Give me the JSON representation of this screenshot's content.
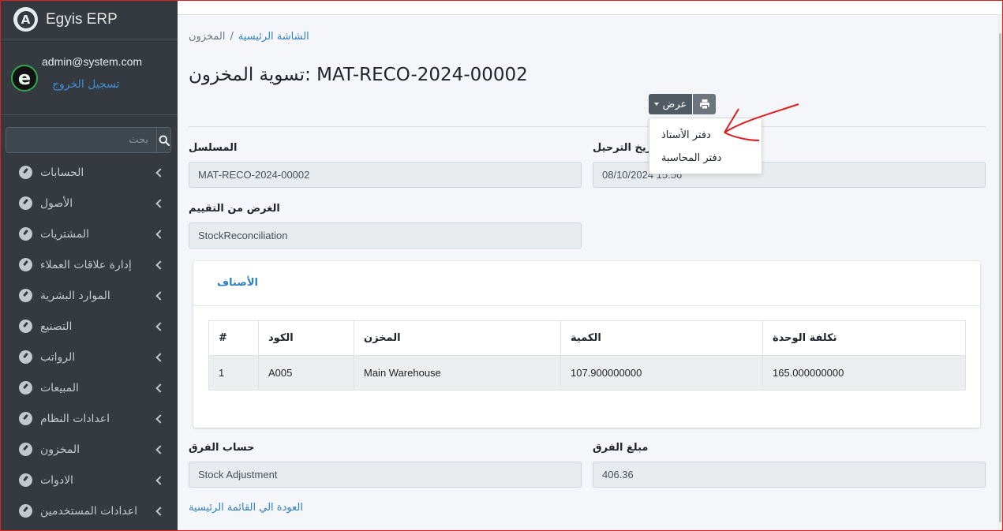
{
  "app": {
    "brand": "Egyis ERP",
    "brand_logo_letter": "A"
  },
  "user": {
    "email": "admin@system.com",
    "logout": "تسجيل الخروج",
    "avatar_letter": "e"
  },
  "sidebar": {
    "search_placeholder": "بحث",
    "items": [
      {
        "label": "الحسابات"
      },
      {
        "label": "الأصول"
      },
      {
        "label": "المشتريات"
      },
      {
        "label": "إدارة علاقات العملاء"
      },
      {
        "label": "الموارد البشرية"
      },
      {
        "label": "التصنيع"
      },
      {
        "label": "الرواتب"
      },
      {
        "label": "المبيعات"
      },
      {
        "label": "اعدادات النظام"
      },
      {
        "label": "المخزون"
      },
      {
        "label": "الادوات"
      },
      {
        "label": "اعدادات المستخدمين"
      }
    ]
  },
  "breadcrumb": {
    "home": "الشاشة الرئيسية",
    "separator": "/",
    "current": "المخزون"
  },
  "page": {
    "title": "تسوية المخزون: MAT-RECO-2024-00002"
  },
  "toolbar": {
    "view_label": "عرض",
    "print_icon": "print-icon"
  },
  "dropdown": {
    "items": [
      "دفتر الأستاذ",
      "دفتر المحاسبة"
    ]
  },
  "form": {
    "series_label": "المسلسل",
    "series_value": "MAT-RECO-2024-00002",
    "posting_date_label": "تاريخ الترحيل",
    "posting_date_value": "08/10/2024 15:56",
    "purpose_label": "الغرض من التقييم",
    "purpose_value": "StockReconciliation",
    "diff_account_label": "حساب الفرق",
    "diff_account_value": "Stock Adjustment",
    "diff_amount_label": "مبلغ الفرق",
    "diff_amount_value": "406.36"
  },
  "items_card": {
    "tab_label": "الأصناف",
    "columns": [
      "#",
      "الكود",
      "المخزن",
      "الكمية",
      "تكلفة الوحدة"
    ],
    "rows": [
      [
        "1",
        "A005",
        "Main Warehouse",
        "107.900000000",
        "165.000000000"
      ]
    ]
  },
  "back_link": "العودة الي القائمة الرئيسية",
  "colors": {
    "sidebar_bg": "#343a40",
    "link": "#2f7fc4",
    "annotation": "#e01e1e"
  }
}
